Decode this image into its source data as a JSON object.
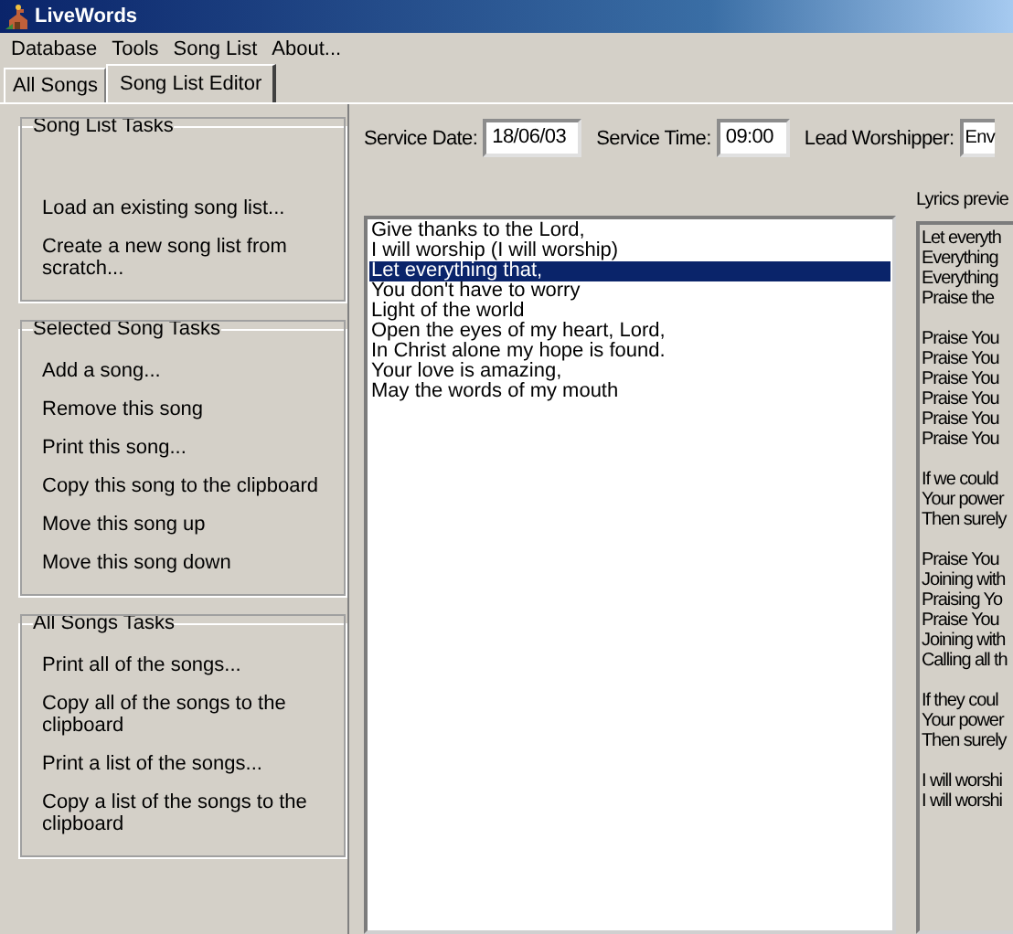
{
  "window": {
    "title": "LiveWords"
  },
  "menu": [
    "Database",
    "Tools",
    "Song List",
    "About..."
  ],
  "tabs": [
    {
      "label": "All Songs",
      "selected": false
    },
    {
      "label": "Song List Editor",
      "selected": true
    }
  ],
  "task_groups": [
    {
      "title": "Song List Tasks",
      "items": [
        "Load an existing song list...",
        "Create a new song list from scratch..."
      ]
    },
    {
      "title": "Selected Song Tasks",
      "items": [
        "Add a song...",
        "Remove this song",
        "Print this song...",
        "Copy this song to the clipboard",
        "Move this song up",
        "Move this song down"
      ]
    },
    {
      "title": "All Songs Tasks",
      "items": [
        "Print all of the songs...",
        "Copy all of the songs to the clipboard",
        "Print a list of the songs...",
        "Copy a list of the songs to the clipboard"
      ]
    }
  ],
  "fields": [
    {
      "label": "Service Date:",
      "value": "18/06/03"
    },
    {
      "label": "Service Time:",
      "value": "09:00"
    },
    {
      "label": "Lead Worshipper:",
      "value": "Env"
    }
  ],
  "songs": [
    {
      "title": "Give thanks to the Lord,",
      "selected": false
    },
    {
      "title": "I will worship (I will worship)",
      "selected": false
    },
    {
      "title": "Let everything that,",
      "selected": true
    },
    {
      "title": "You don't have to worry",
      "selected": false
    },
    {
      "title": "Light of the world",
      "selected": false
    },
    {
      "title": "Open the eyes of my heart, Lord,",
      "selected": false
    },
    {
      "title": "In Christ alone my hope is found.",
      "selected": false
    },
    {
      "title": "Your love is amazing,",
      "selected": false
    },
    {
      "title": "May the words of my mouth",
      "selected": false
    }
  ],
  "lyrics_preview": {
    "label": "Lyrics previe",
    "stanzas": [
      [
        "Let everyth",
        "Everything",
        "Everything",
        "Praise the"
      ],
      [
        "Praise You",
        "Praise You",
        "Praise You",
        "Praise You",
        "Praise You",
        "Praise You"
      ],
      [
        "If we could",
        "Your power",
        "Then surely"
      ],
      [
        "Praise You",
        "Joining with",
        "Praising Yo",
        "Praise You",
        "Joining with",
        "Calling all th"
      ],
      [
        "If they coul",
        "Your power",
        "Then surely"
      ],
      [
        "I will worshi",
        "I will worshi"
      ]
    ]
  }
}
